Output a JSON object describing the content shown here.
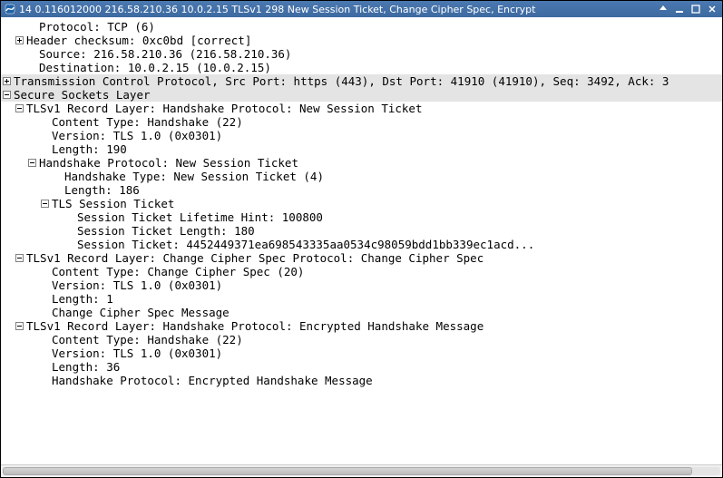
{
  "window": {
    "title": "14 0.116012000 216.58.210.36 10.0.2.15 TLSv1 298 New Session Ticket, Change Cipher Spec, Encrypt"
  },
  "tree": [
    {
      "indent": 2,
      "tw": "",
      "text": "Protocol: TCP (6)"
    },
    {
      "indent": 1,
      "tw": "plus",
      "text": "Header checksum: 0xc0bd [correct]"
    },
    {
      "indent": 2,
      "tw": "",
      "text": "Source: 216.58.210.36 (216.58.210.36)"
    },
    {
      "indent": 2,
      "tw": "",
      "text": "Destination: 10.0.2.15 (10.0.2.15)"
    },
    {
      "indent": 0,
      "tw": "plus",
      "text": "Transmission Control Protocol, Src Port: https (443), Dst Port: 41910 (41910), Seq: 3492, Ack: 3",
      "hl": true
    },
    {
      "indent": 0,
      "tw": "minus",
      "text": "Secure Sockets Layer",
      "hl": true
    },
    {
      "indent": 1,
      "tw": "minus",
      "text": "TLSv1 Record Layer: Handshake Protocol: New Session Ticket"
    },
    {
      "indent": 3,
      "tw": "",
      "text": "Content Type: Handshake (22)"
    },
    {
      "indent": 3,
      "tw": "",
      "text": "Version: TLS 1.0 (0x0301)"
    },
    {
      "indent": 3,
      "tw": "",
      "text": "Length: 190"
    },
    {
      "indent": 2,
      "tw": "minus",
      "text": "Handshake Protocol: New Session Ticket"
    },
    {
      "indent": 4,
      "tw": "",
      "text": "Handshake Type: New Session Ticket (4)"
    },
    {
      "indent": 4,
      "tw": "",
      "text": "Length: 186"
    },
    {
      "indent": 3,
      "tw": "minus",
      "text": "TLS Session Ticket"
    },
    {
      "indent": 5,
      "tw": "",
      "text": "Session Ticket Lifetime Hint: 100800"
    },
    {
      "indent": 5,
      "tw": "",
      "text": "Session Ticket Length: 180"
    },
    {
      "indent": 5,
      "tw": "",
      "text": "Session Ticket: 4452449371ea698543335aa0534c98059bdd1bb339ec1acd..."
    },
    {
      "indent": 1,
      "tw": "minus",
      "text": "TLSv1 Record Layer: Change Cipher Spec Protocol: Change Cipher Spec"
    },
    {
      "indent": 3,
      "tw": "",
      "text": "Content Type: Change Cipher Spec (20)"
    },
    {
      "indent": 3,
      "tw": "",
      "text": "Version: TLS 1.0 (0x0301)"
    },
    {
      "indent": 3,
      "tw": "",
      "text": "Length: 1"
    },
    {
      "indent": 3,
      "tw": "",
      "text": "Change Cipher Spec Message"
    },
    {
      "indent": 1,
      "tw": "minus",
      "text": "TLSv1 Record Layer: Handshake Protocol: Encrypted Handshake Message"
    },
    {
      "indent": 3,
      "tw": "",
      "text": "Content Type: Handshake (22)"
    },
    {
      "indent": 3,
      "tw": "",
      "text": "Version: TLS 1.0 (0x0301)"
    },
    {
      "indent": 3,
      "tw": "",
      "text": "Length: 36"
    },
    {
      "indent": 3,
      "tw": "",
      "text": "Handshake Protocol: Encrypted Handshake Message"
    }
  ]
}
